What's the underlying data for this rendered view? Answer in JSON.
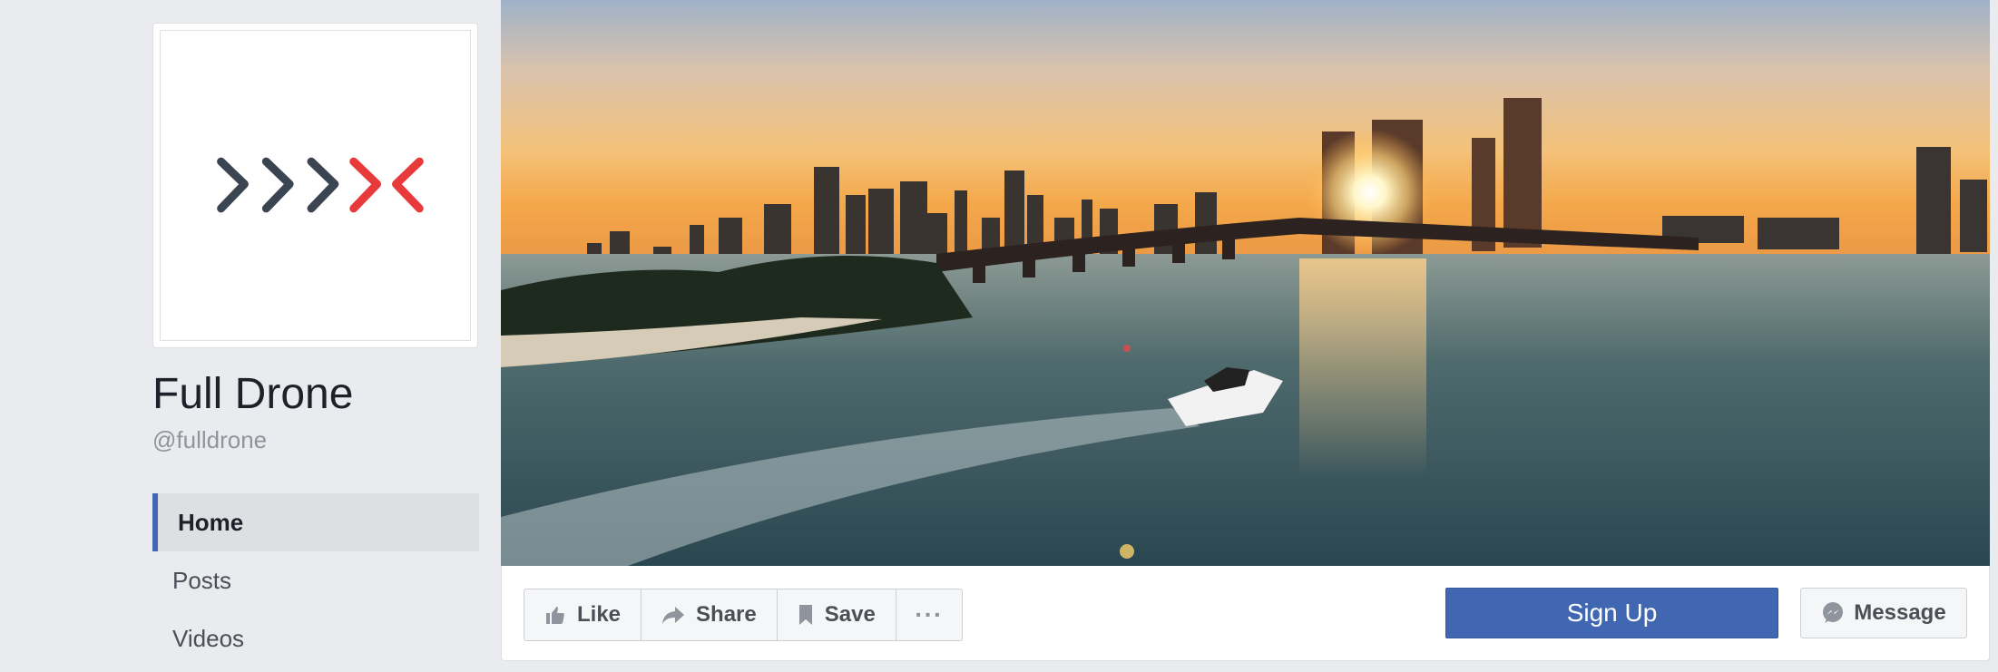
{
  "page": {
    "name": "Full Drone",
    "handle": "@fulldrone"
  },
  "nav": {
    "items": [
      {
        "label": "Home",
        "active": true
      },
      {
        "label": "Posts",
        "active": false
      },
      {
        "label": "Videos",
        "active": false
      }
    ]
  },
  "actions": {
    "like_label": "Like",
    "share_label": "Share",
    "save_label": "Save",
    "more_label": "···",
    "signup_label": "Sign Up",
    "message_label": "Message"
  },
  "colors": {
    "brand_blue": "#4267b2",
    "logo_dark": "#3b4451",
    "logo_red": "#e83a3a"
  },
  "icons": {
    "like": "thumbs-up-icon",
    "share": "share-arrow-icon",
    "save": "bookmark-icon",
    "more": "more-dots-icon",
    "message": "messenger-icon"
  }
}
